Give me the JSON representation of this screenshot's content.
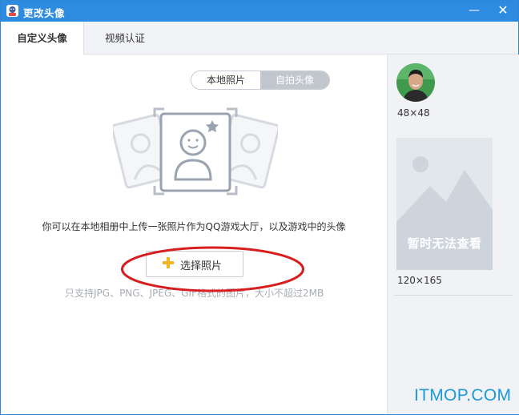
{
  "window": {
    "title": "更改头像",
    "minimize": "—",
    "close": "✕"
  },
  "tabs": [
    {
      "label": "自定义头像",
      "active": true
    },
    {
      "label": "视频认证",
      "active": false
    }
  ],
  "source_toggle": {
    "local_label": "本地照片",
    "selfie_label": "自拍头像",
    "selected": "自拍头像"
  },
  "main": {
    "description": "你可以在本地相册中上传一张照片作为QQ游戏大厅，以及游戏中的头像",
    "choose_button_label": "选择照片",
    "hint": "只支持JPG、PNG、JPEG、GIF格式的图片，大小不超过2MB"
  },
  "preview": {
    "small_size_label": "48×48",
    "large_size_label": "120×165",
    "large_placeholder_text": "暂时无法查看"
  },
  "watermark": "ITMOP.COM",
  "colors": {
    "titlebar": "#2d8be0",
    "accent_plus": "#f3b425",
    "annotation_ellipse": "#d81e1e",
    "watermark": "#1c9ad8"
  },
  "icons": {
    "app": "game-app-icon",
    "choose": "plus-icon",
    "illustration": "photo-frame-illustration"
  }
}
